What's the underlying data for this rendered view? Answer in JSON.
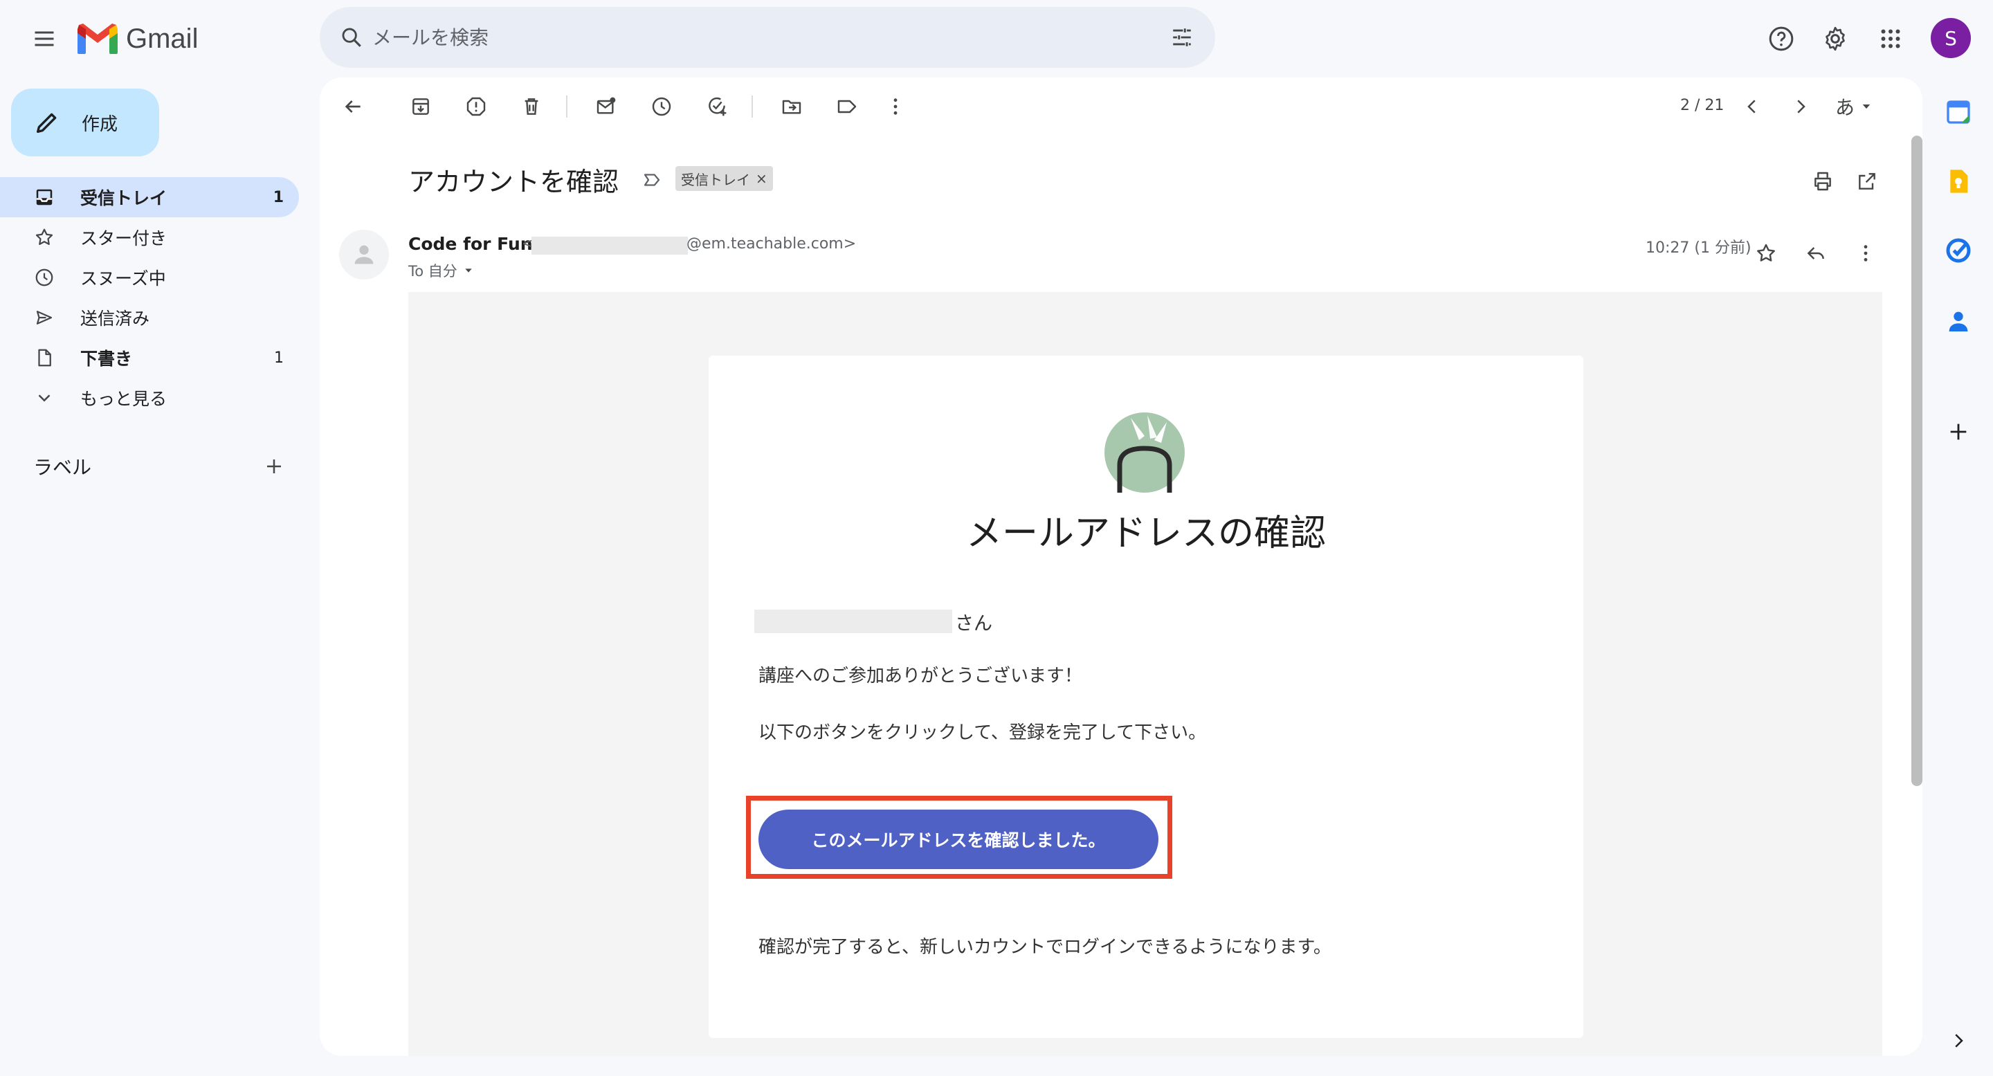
{
  "app": {
    "name": "Gmail"
  },
  "search": {
    "placeholder": "メールを検索"
  },
  "account": {
    "avatar_letter": "S"
  },
  "compose": {
    "label": "作成"
  },
  "nav": {
    "items": [
      {
        "label": "受信トレイ",
        "count": "1",
        "icon": "inbox-icon"
      },
      {
        "label": "スター付き",
        "count": "",
        "icon": "star-icon"
      },
      {
        "label": "スヌーズ中",
        "count": "",
        "icon": "clock-icon"
      },
      {
        "label": "送信済み",
        "count": "",
        "icon": "send-icon"
      },
      {
        "label": "下書き",
        "count": "1",
        "icon": "draft-icon"
      },
      {
        "label": "もっと見る",
        "count": "",
        "icon": "chevron-down-icon"
      }
    ]
  },
  "labels": {
    "title": "ラベル"
  },
  "toolbar": {
    "pager": "2 / 21",
    "input_language": "あ"
  },
  "email": {
    "subject": "アカウントを確認",
    "label_chip": "受信トレイ",
    "sender_name": "Code for Fun",
    "sender_email_open": "<",
    "sender_email_domain": "@em.teachable.com>",
    "to": "To 自分",
    "time": "10:27 (1 分前)"
  },
  "message": {
    "title": "メールアドレスの確認",
    "greeting_suffix": "さん",
    "line1": "講座へのご参加ありがとうございます！",
    "line2": "以下のボタンをクリックして、登録を完了して下さい。",
    "button_label": "このメールアドレスを確認しました。",
    "line3": "確認が完了すると、新しいカウントでログインできるようになります。"
  },
  "colors": {
    "accent_button": "#4f61c4",
    "highlight_box": "#e8432a",
    "avatar": "#7b1fa2",
    "compose_bg": "#c2e7ff",
    "nav_active": "#d3e3fd"
  }
}
